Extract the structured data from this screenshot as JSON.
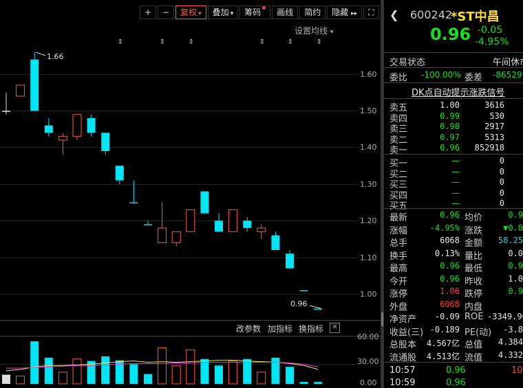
{
  "toolbar": {
    "plus_label": "+",
    "minus_label": "−",
    "fuquan_label": "复权",
    "diejia_label": "叠加",
    "chouma_label": "筹码",
    "huaxian_label": "画线",
    "jianyue_label": "简约",
    "yincang_label": "隐藏",
    "next_label": "▸▸",
    "fullscreen_label": "⛶",
    "settings_label": "设置均线"
  },
  "colors": {
    "up": "#ff5b3a",
    "down": "#00e5f5",
    "ma1": "#f0e060",
    "ma2": "#e040e0"
  },
  "chart_data": {
    "type": "candlestick",
    "y_ticks": [
      "1.60",
      "1.50",
      "1.40",
      "1.30",
      "1.20",
      "1.10",
      "1.00"
    ],
    "ylim": [
      0.96,
      1.7
    ],
    "high_label": "1.66",
    "low_label": "0.96",
    "candles": [
      {
        "o": 1.5,
        "c": 1.5,
        "h": 1.55,
        "l": 1.49,
        "dir": "flat"
      },
      {
        "o": 1.54,
        "c": 1.57,
        "h": 1.57,
        "l": 1.54,
        "dir": "up"
      },
      {
        "o": 1.64,
        "c": 1.5,
        "h": 1.66,
        "l": 1.5,
        "dir": "down"
      },
      {
        "o": 1.46,
        "c": 1.44,
        "h": 1.48,
        "l": 1.43,
        "dir": "down"
      },
      {
        "o": 1.42,
        "c": 1.43,
        "h": 1.44,
        "l": 1.38,
        "dir": "up"
      },
      {
        "o": 1.43,
        "c": 1.49,
        "h": 1.49,
        "l": 1.42,
        "dir": "up"
      },
      {
        "o": 1.48,
        "c": 1.44,
        "h": 1.49,
        "l": 1.43,
        "dir": "down"
      },
      {
        "o": 1.44,
        "c": 1.39,
        "h": 1.44,
        "l": 1.38,
        "dir": "down"
      },
      {
        "o": 1.35,
        "c": 1.31,
        "h": 1.35,
        "l": 1.3,
        "dir": "down"
      },
      {
        "o": 1.25,
        "c": 1.25,
        "h": 1.31,
        "l": 1.25,
        "dir": "down"
      },
      {
        "o": 1.19,
        "c": 1.19,
        "h": 1.2,
        "l": 1.19,
        "dir": "down"
      },
      {
        "o": 1.14,
        "c": 1.18,
        "h": 1.25,
        "l": 1.14,
        "dir": "up"
      },
      {
        "o": 1.14,
        "c": 1.17,
        "h": 1.17,
        "l": 1.13,
        "dir": "up"
      },
      {
        "o": 1.17,
        "c": 1.23,
        "h": 1.23,
        "l": 1.17,
        "dir": "up"
      },
      {
        "o": 1.28,
        "c": 1.22,
        "h": 1.28,
        "l": 1.22,
        "dir": "down"
      },
      {
        "o": 1.2,
        "c": 1.17,
        "h": 1.22,
        "l": 1.17,
        "dir": "down"
      },
      {
        "o": 1.17,
        "c": 1.23,
        "h": 1.23,
        "l": 1.17,
        "dir": "up"
      },
      {
        "o": 1.2,
        "c": 1.18,
        "h": 1.21,
        "l": 1.17,
        "dir": "down"
      },
      {
        "o": 1.17,
        "c": 1.18,
        "h": 1.19,
        "l": 1.15,
        "dir": "up"
      },
      {
        "o": 1.16,
        "c": 1.12,
        "h": 1.17,
        "l": 1.12,
        "dir": "down"
      },
      {
        "o": 1.11,
        "c": 1.07,
        "h": 1.12,
        "l": 1.07,
        "dir": "down"
      },
      {
        "o": 1.01,
        "c": 1.01,
        "h": 1.01,
        "l": 1.01,
        "dir": "down"
      },
      {
        "o": 0.96,
        "c": 0.96,
        "h": 0.96,
        "l": 0.96,
        "dir": "down"
      }
    ],
    "volume_ticks": [
      "60.00",
      "30.00",
      "0.00"
    ],
    "volume_ylim": [
      0,
      65
    ],
    "volumes": [
      {
        "v": 14,
        "dir": "flat"
      },
      {
        "v": 12,
        "dir": "up"
      },
      {
        "v": 65,
        "dir": "down"
      },
      {
        "v": 40,
        "dir": "down"
      },
      {
        "v": 18,
        "dir": "up"
      },
      {
        "v": 38,
        "dir": "up"
      },
      {
        "v": 35,
        "dir": "down"
      },
      {
        "v": 42,
        "dir": "down"
      },
      {
        "v": 36,
        "dir": "down"
      },
      {
        "v": 30,
        "dir": "down"
      },
      {
        "v": 15,
        "dir": "down"
      },
      {
        "v": 55,
        "dir": "up"
      },
      {
        "v": 28,
        "dir": "up"
      },
      {
        "v": 52,
        "dir": "up"
      },
      {
        "v": 38,
        "dir": "down"
      },
      {
        "v": 28,
        "dir": "down"
      },
      {
        "v": 35,
        "dir": "up"
      },
      {
        "v": 38,
        "dir": "down"
      },
      {
        "v": 18,
        "dir": "up"
      },
      {
        "v": 40,
        "dir": "down"
      },
      {
        "v": 26,
        "dir": "down"
      },
      {
        "v": 3,
        "dir": "down"
      },
      {
        "v": 3,
        "dir": "down"
      }
    ],
    "vol_ma1": [
      20,
      22,
      26,
      28,
      28,
      29,
      30,
      32,
      34,
      35,
      33,
      34,
      33,
      34,
      35,
      36,
      36,
      35,
      34,
      33,
      31,
      28,
      22
    ],
    "vol_ma2": [
      24,
      24,
      25,
      26,
      27,
      28,
      28,
      29,
      30,
      31,
      31,
      31,
      32,
      32,
      33,
      33,
      33,
      33,
      33,
      33,
      32,
      30,
      26
    ]
  },
  "indicator_bar": {
    "gaicanshu": "改参数",
    "jiazhibiao": "加指标",
    "huanzhibiao": "换指标",
    "close": "✕"
  },
  "stock": {
    "code": "600242",
    "name": "*ST中昌",
    "price": "0.96",
    "change": "-0.05",
    "change_pct": "-4.95%"
  },
  "status": {
    "label": "交易状态",
    "value": "午间休市"
  },
  "weibi": {
    "label1": "委比",
    "value1": "-100.00%",
    "label2": "委差",
    "value2": "-86529"
  },
  "dk_signal": "DK点自动提示涨跌信号",
  "sell": [
    {
      "label": "卖五",
      "price": "1.00",
      "vol": "3616"
    },
    {
      "label": "卖四",
      "price": "0.99",
      "vol": "530"
    },
    {
      "label": "卖三",
      "price": "0.98",
      "vol": "2917"
    },
    {
      "label": "卖二",
      "price": "0.97",
      "vol": "5313"
    },
    {
      "label": "卖一",
      "price": "0.96",
      "vol": "852918"
    }
  ],
  "buy": [
    {
      "label": "买一",
      "price": "—",
      "vol": "0"
    },
    {
      "label": "买二",
      "price": "—",
      "vol": "0"
    },
    {
      "label": "买三",
      "price": "—",
      "vol": "0"
    },
    {
      "label": "买四",
      "price": "—",
      "vol": "0"
    },
    {
      "label": "买五",
      "price": "—",
      "vol": "0"
    }
  ],
  "stats": [
    {
      "l1": "最新",
      "v1": "0.96",
      "c1": "green",
      "l2": "均价",
      "v2": "0.9",
      "c2": "green"
    },
    {
      "l1": "涨幅",
      "v1": "-4.95%",
      "c1": "green",
      "l2": "涨跌",
      "v2": "▼0.0",
      "c2": "green"
    },
    {
      "l1": "总手",
      "v1": "6068",
      "c1": "white",
      "l2": "金额",
      "v2": "58.25",
      "c2": "cyan"
    },
    {
      "l1": "换手",
      "v1": "0.13%",
      "c1": "white",
      "l2": "量比",
      "v2": "0.0",
      "c2": "white"
    },
    {
      "l1": "最高",
      "v1": "0.96",
      "c1": "green",
      "l2": "最低",
      "v2": "0.9",
      "c2": "green"
    },
    {
      "l1": "今开",
      "v1": "0.96",
      "c1": "green",
      "l2": "昨收",
      "v2": "1.0",
      "c2": "white"
    },
    {
      "l1": "涨停",
      "v1": "1.06",
      "c1": "red",
      "l2": "跌停",
      "v2": "0.9",
      "c2": "green"
    },
    {
      "l1": "外盘",
      "v1": "6068",
      "c1": "red",
      "l2": "内盘",
      "v2": "",
      "c2": "green"
    },
    {
      "l1": "净资产",
      "v1": "-0.09",
      "c1": "white",
      "l2": "ROE",
      "v2": "-3349.90",
      "c2": "white"
    },
    {
      "l1": "收益(三)",
      "v1": "-0.189",
      "c1": "white",
      "l2": "PE(动)",
      "v2": "-3.8",
      "c2": "white"
    },
    {
      "l1": "总股本",
      "v1": "4.567亿",
      "c1": "white",
      "l2": "总值",
      "v2": "4.384",
      "c2": "white"
    },
    {
      "l1": "流通股",
      "v1": "4.513亿",
      "c1": "white",
      "l2": "流值",
      "v2": "4.332",
      "c2": "white"
    }
  ],
  "ticks": [
    {
      "time": "10:57",
      "price": "0.96",
      "vol": "10"
    },
    {
      "time": "10:59",
      "price": "0.96",
      "vol": ""
    }
  ]
}
